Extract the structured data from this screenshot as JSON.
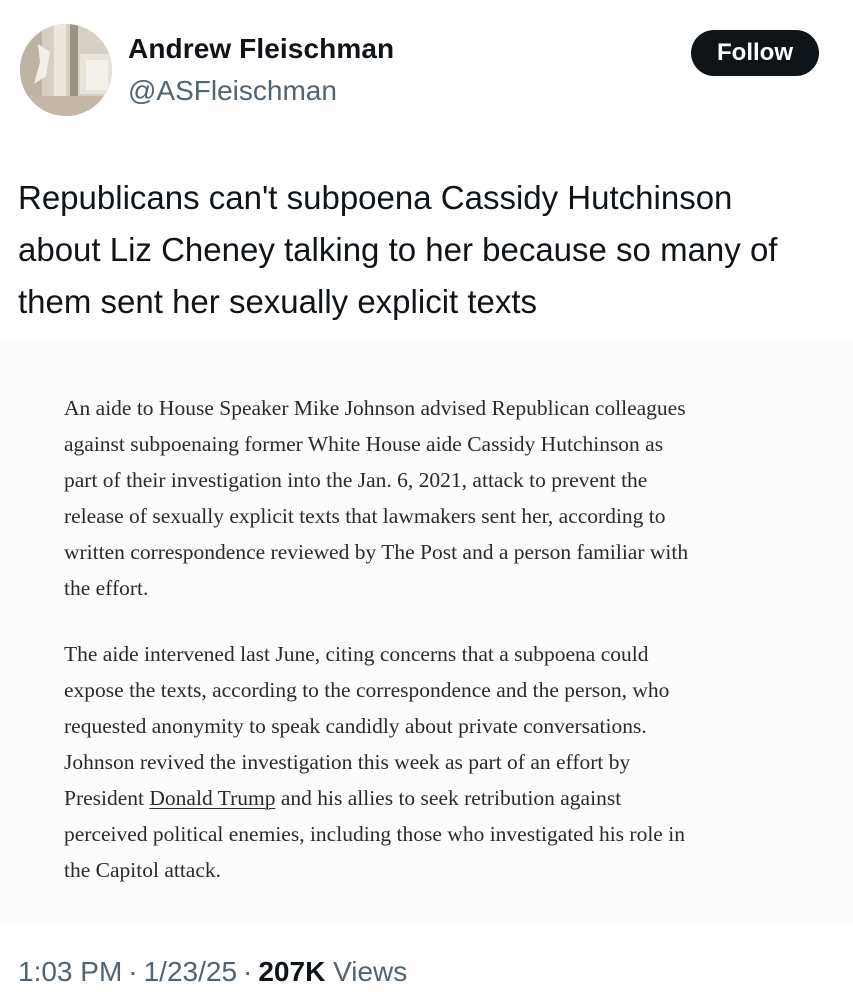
{
  "author": {
    "name": "Andrew Fleischman",
    "handle": "@ASFleischman"
  },
  "follow_button": {
    "label": "Follow"
  },
  "tweet": {
    "text_lines": [
      "Republicans can't subpoena Cassidy Hutchinson",
      "about Liz Cheney talking to her because so many of",
      "them sent her sexually explicit texts"
    ]
  },
  "article_image": {
    "paragraph1_lines": [
      "An aide to House Speaker Mike Johnson advised Republican colleagues",
      "against subpoenaing former White House aide Cassidy Hutchinson as",
      "part of their investigation into the Jan. 6, 2021, attack to prevent the",
      "release of sexually explicit texts that lawmakers sent her, according to",
      "written correspondence reviewed by The Post and a person familiar with",
      "the effort."
    ],
    "paragraph2_lines": [
      "The aide intervened last June, citing concerns that a subpoena could",
      "expose the texts, according to the correspondence and the person, who",
      "requested anonymity to speak candidly about private conversations.",
      "Johnson revived the investigation this week as part of an effort by"
    ],
    "paragraph2_line5_before": "President ",
    "paragraph2_line5_link": "Donald Trump",
    "paragraph2_line5_after": " and his allies to seek retribution against",
    "paragraph2_lines_end": [
      "perceived political enemies, including those who investigated his role in",
      "the Capitol attack."
    ]
  },
  "meta": {
    "time": "1:03 PM",
    "separator": "·",
    "date": "1/23/25",
    "views_count": "207K",
    "views_label": "Views"
  },
  "colors": {
    "text_primary": "#0f1419",
    "text_secondary": "#536471",
    "button_bg": "#0f1419",
    "button_text": "#ffffff"
  }
}
